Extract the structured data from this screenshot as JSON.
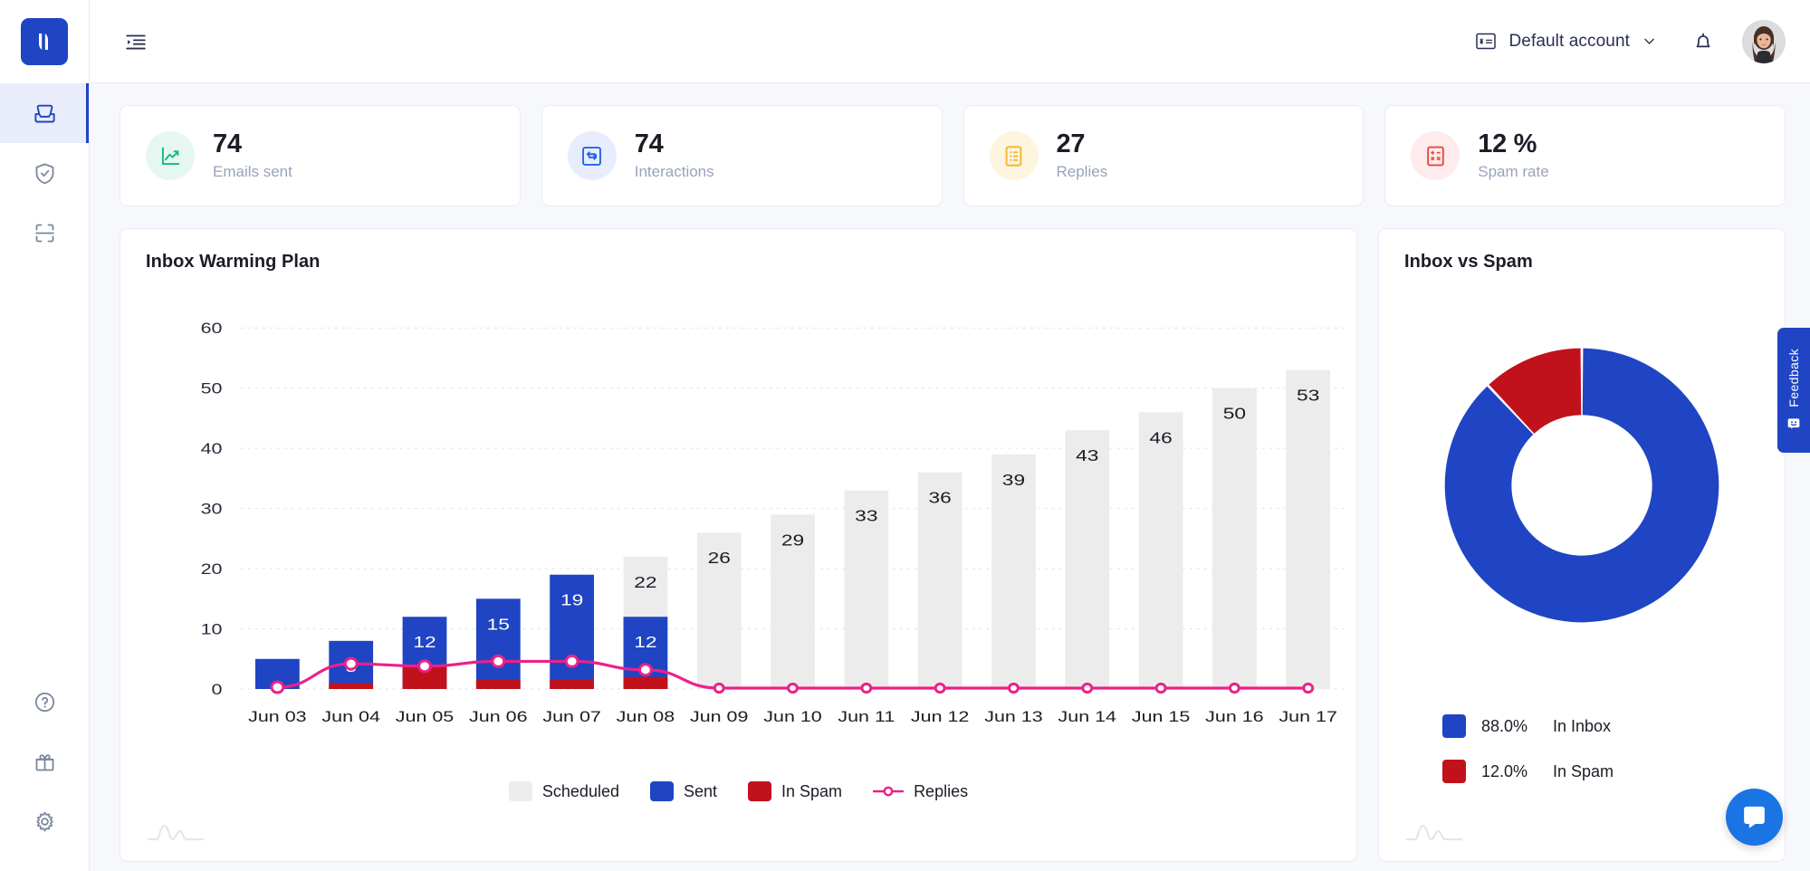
{
  "brand": {
    "logo_icon": "bar-chart-logo-icon",
    "color": "#1f45c4"
  },
  "sidebar": {
    "top_items": [
      {
        "name": "inbox",
        "icon": "inbox-icon",
        "active": true
      },
      {
        "name": "deliverability",
        "icon": "shield-check-icon",
        "active": false
      },
      {
        "name": "scan",
        "icon": "scan-frame-icon",
        "active": false
      }
    ],
    "bottom_items": [
      {
        "name": "help",
        "icon": "question-circle-icon"
      },
      {
        "name": "rewards",
        "icon": "gift-icon"
      },
      {
        "name": "settings",
        "icon": "gear-icon"
      }
    ]
  },
  "topbar": {
    "collapse_icon": "sidebar-collapse-icon",
    "account": {
      "icon": "account-card-icon",
      "label": "Default account",
      "chevron": "chevron-down-icon"
    },
    "notifications_icon": "bell-icon",
    "avatar_alt": "user-avatar"
  },
  "stats": [
    {
      "value": "74",
      "label": "Emails sent",
      "icon": "line-chart-icon",
      "icon_color": "#13b981",
      "bg": "#e6f7f1"
    },
    {
      "value": "74",
      "label": "Interactions",
      "icon": "repeat-icon",
      "icon_color": "#2563eb",
      "bg": "#e7edfd"
    },
    {
      "value": "27",
      "label": "Replies",
      "icon": "list-document-icon",
      "icon_color": "#f5b731",
      "bg": "#fdf5e0"
    },
    {
      "value": "12 %",
      "label": "Spam rate",
      "icon": "calculator-icon",
      "icon_color": "#e8493f",
      "bg": "#fdeceb"
    }
  ],
  "chart_panel": {
    "title": "Inbox Warming Plan"
  },
  "donut_panel": {
    "title": "Inbox vs Spam"
  },
  "feedback": {
    "label": "Feedback",
    "icon": "smiley-face-icon"
  },
  "intercom": {
    "icon": "chat-bubble-icon"
  },
  "chart_data": [
    {
      "id": "inbox-warming-plan",
      "type": "bar",
      "title": "Inbox Warming Plan",
      "xlabel": "",
      "ylabel": "",
      "ylim": [
        0,
        65
      ],
      "yticks": [
        0,
        10,
        20,
        30,
        40,
        50,
        60
      ],
      "grid": true,
      "legend_position": "bottom",
      "categories": [
        "Jun 03",
        "Jun 04",
        "Jun 05",
        "Jun 06",
        "Jun 07",
        "Jun 08",
        "Jun 09",
        "Jun 10",
        "Jun 11",
        "Jun 12",
        "Jun 13",
        "Jun 14",
        "Jun 15",
        "Jun 16",
        "Jun 17"
      ],
      "series": [
        {
          "name": "Scheduled",
          "color": "#ececec",
          "values": [
            0,
            0,
            0,
            0,
            0,
            22,
            26,
            29,
            33,
            36,
            39,
            43,
            46,
            50,
            53
          ],
          "labels": [
            "",
            "",
            "",
            "",
            "",
            "22",
            "26",
            "29",
            "33",
            "36",
            "39",
            "43",
            "46",
            "50",
            "53"
          ]
        },
        {
          "name": "Sent",
          "color": "#1f45c4",
          "values": [
            5,
            8,
            12,
            15,
            19,
            12,
            0,
            0,
            0,
            0,
            0,
            0,
            0,
            0,
            0
          ],
          "labels": [
            "",
            "8",
            "12",
            "15",
            "19",
            "12",
            "",
            "",
            "",
            "",
            "",
            "",
            "",
            "",
            ""
          ]
        },
        {
          "name": "In Spam",
          "color": "#c1121c",
          "values": [
            0,
            1,
            4,
            1.5,
            1.5,
            2,
            0,
            0,
            0,
            0,
            0,
            0,
            0,
            0,
            0
          ],
          "labels": [
            "",
            "",
            "",
            "",
            "",
            "",
            "",
            "",
            "",
            "",
            "",
            "",
            "",
            "",
            ""
          ]
        },
        {
          "name": "Replies",
          "color": "#ec2188",
          "type": "line",
          "values": [
            0.3,
            4.2,
            3.8,
            4.6,
            4.6,
            3.2,
            0.15,
            0.15,
            0.15,
            0.15,
            0.15,
            0.15,
            0.15,
            0.15,
            0.15
          ]
        }
      ]
    },
    {
      "id": "inbox-vs-spam",
      "type": "pie",
      "title": "Inbox vs Spam",
      "donut": true,
      "legend_position": "bottom-left",
      "labels": [
        "In Inbox",
        "In Spam"
      ],
      "values": [
        88.0,
        12.0
      ],
      "display_values": [
        "88.0%",
        "12.0%"
      ],
      "colors": [
        "#1f45c4",
        "#c1121c"
      ]
    }
  ]
}
